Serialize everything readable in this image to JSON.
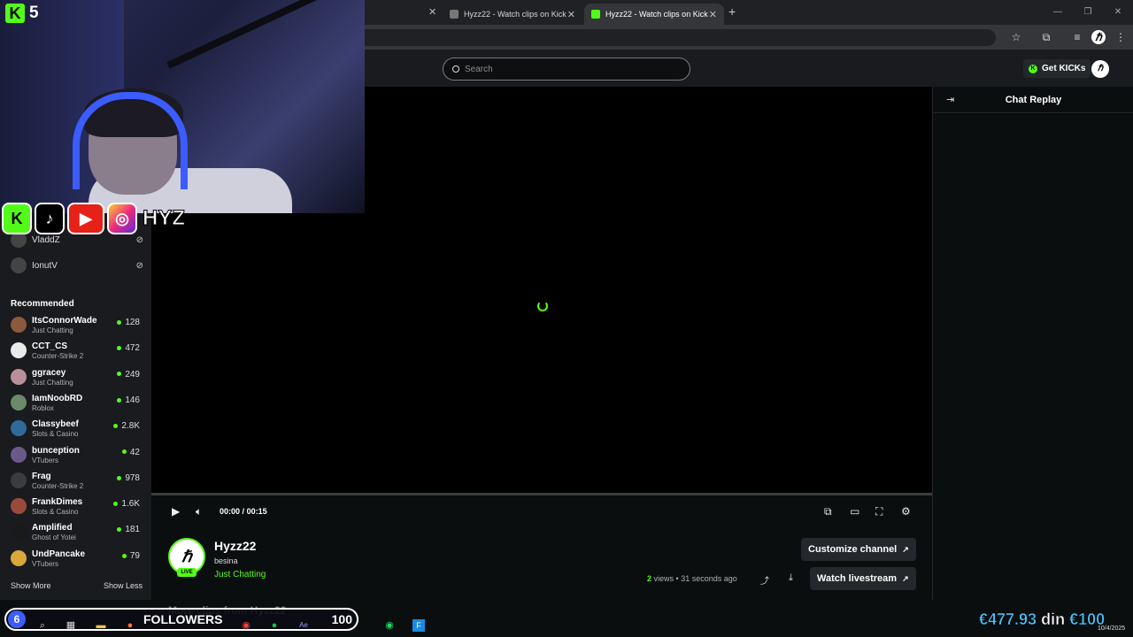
{
  "browser": {
    "tabs": [
      {
        "title": "Hyzz22 - Watch clips on Kick"
      },
      {
        "title": "Hyzz22 - Watch clips on Kick"
      }
    ],
    "new_tab": "+",
    "window_controls": [
      "—",
      "❐",
      "✕"
    ]
  },
  "header": {
    "search_placeholder": "Search",
    "get_kicks_label": "Get KICKs",
    "user_avatar": "ℏ"
  },
  "sidebar": {
    "following": [
      {
        "name": "VladdZ"
      },
      {
        "name": "IonutV"
      }
    ],
    "recommended_title": "Recommended",
    "recommended": [
      {
        "name": "ItsConnorWade",
        "category": "Just Chatting",
        "viewers": "128",
        "color": "#8a5a3c"
      },
      {
        "name": "CCT_CS",
        "category": "Counter-Strike 2",
        "viewers": "472",
        "color": "#eaeaea"
      },
      {
        "name": "ggracey",
        "category": "Just Chatting",
        "viewers": "249",
        "color": "#b88f9a"
      },
      {
        "name": "IamNoobRD",
        "category": "Roblox",
        "viewers": "146",
        "color": "#6a8a6a"
      },
      {
        "name": "Classybeef",
        "category": "Slots & Casino",
        "viewers": "2.8K",
        "color": "#2f6a9a"
      },
      {
        "name": "bunception",
        "category": "VTubers",
        "viewers": "42",
        "color": "#6a5a8a"
      },
      {
        "name": "Frag",
        "category": "Counter-Strike 2",
        "viewers": "978",
        "color": "#3a3d40"
      },
      {
        "name": "FrankDimes",
        "category": "Slots & Casino",
        "viewers": "1.6K",
        "color": "#9a4a3a"
      },
      {
        "name": "Amplified",
        "category": "Ghost of Yotei",
        "viewers": "181",
        "color": "#1a1a1a"
      },
      {
        "name": "UndPancake",
        "category": "VTubers",
        "viewers": "79",
        "color": "#d9a83a"
      }
    ],
    "show_more": "Show More",
    "show_less": "Show Less"
  },
  "player": {
    "time_current": "00:00",
    "time_sep": "/",
    "time_total": "00:15",
    "progress": 0
  },
  "channel": {
    "name": "Hyzz22",
    "clip_title": "besina",
    "category": "Just Chatting",
    "live_badge": "LIVE",
    "views_count": "2",
    "views_label": "views",
    "age": "31 seconds ago",
    "customize_label": "Customize channel",
    "watch_live_label": "Watch livestream"
  },
  "chat": {
    "title": "Chat Replay"
  },
  "overlay": {
    "kick_badge": "K",
    "kick_count": "5",
    "socials_name": "HYZ",
    "followers_count": "6",
    "followers_label": "FOLLOWERS",
    "followers_goal": "100",
    "more_clips": "More clips from Hyzz22",
    "donation_amount": "€477.93",
    "donation_word": "din",
    "donation_goal": "€100",
    "clock_date": "10/4/2025"
  },
  "colors": {
    "kick_green": "#53fc18",
    "bg": "#0b0e0f",
    "panel": "#191b1f"
  }
}
